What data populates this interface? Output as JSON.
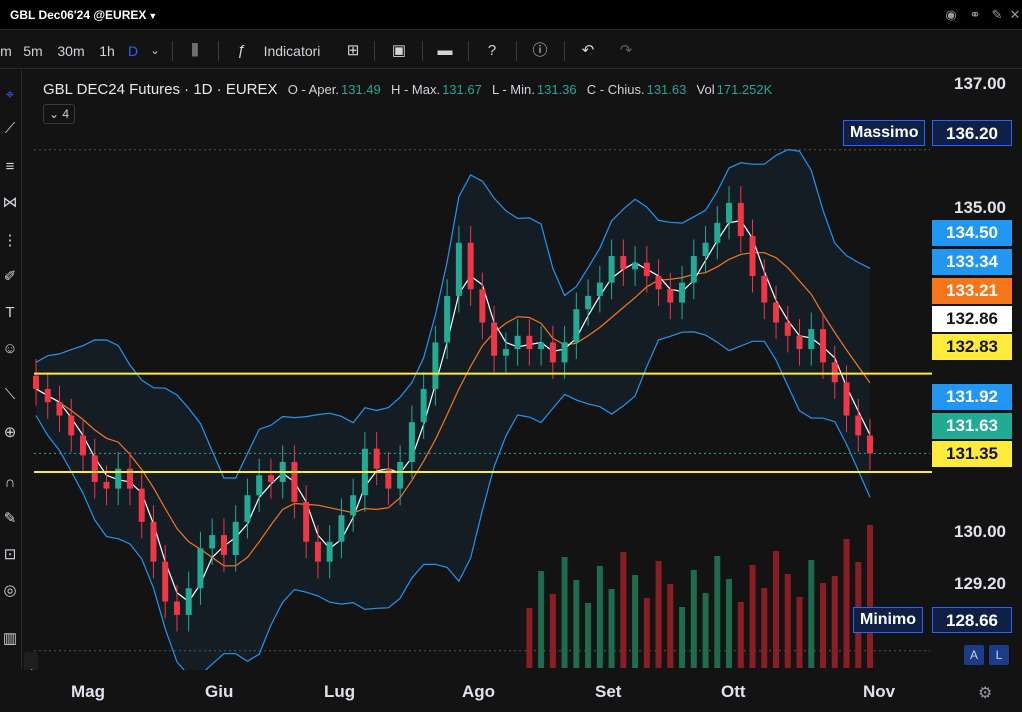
{
  "window": {
    "title": "GBL Dec06'24 @EUREX"
  },
  "toolbar": {
    "tf_m": "m",
    "tf_5m": "5m",
    "tf_30m": "30m",
    "tf_1h": "1h",
    "tf_d": "D",
    "indicators_label": "Indicatori"
  },
  "legend": {
    "symbol": "GBL DEC24 Futures · 1D · EUREX",
    "open_label": "O - Aper.",
    "open": "131.49",
    "high_label": "H - Max.",
    "high": "131.67",
    "low_label": "L - Min.",
    "low": "131.36",
    "close_label": "C - Chius.",
    "close": "131.63",
    "vol_label": "Vol",
    "vol": "171.252K",
    "indicator_count": "4"
  },
  "price_axis": {
    "ticks": [
      "137.00",
      "135.00",
      "130.00",
      "129.20"
    ],
    "max_tag": "Massimo",
    "max_value": "136.20",
    "min_tag": "Minimo",
    "min_value": "128.66",
    "labels": [
      {
        "value": "134.50",
        "color": "#2196f3",
        "text_color": "#ffffff"
      },
      {
        "value": "133.34",
        "color": "#2196f3",
        "text_color": "#ffffff"
      },
      {
        "value": "133.21",
        "color": "#f7761c",
        "text_color": "#ffffff"
      },
      {
        "value": "132.86",
        "color": "#ffffff",
        "text_color": "#131313"
      },
      {
        "value": "132.83",
        "color": "#ffeb3b",
        "text_color": "#131313"
      },
      {
        "value": "131.92",
        "color": "#2196f3",
        "text_color": "#ffffff"
      },
      {
        "value": "131.63",
        "color": "#22ab94",
        "text_color": "#ffffff"
      },
      {
        "value": "131.35",
        "color": "#ffeb3b",
        "text_color": "#131313"
      }
    ]
  },
  "time_axis": {
    "months": [
      "Mag",
      "Giu",
      "Lug",
      "Ago",
      "Set",
      "Ott",
      "Nov"
    ]
  },
  "scale_buttons": {
    "auto": "A",
    "log": "L"
  },
  "colors": {
    "up": "#22ab94",
    "down": "#f23645",
    "hline": "#ffeb3b",
    "band": "#2196f3",
    "ma_fast": "#ffffff",
    "ma_slow": "#f7761c"
  },
  "chart_data": {
    "type": "candlestick",
    "title": "GBL DEC24 Futures · 1D · EUREX",
    "ylim": [
      128.4,
      137.4
    ],
    "horizontal_lines": [
      132.83,
      131.35
    ],
    "last": {
      "open": 131.49,
      "high": 131.67,
      "low": 131.36,
      "close": 131.63,
      "volume": "171.252K"
    },
    "x": [
      "Mag",
      "Giu",
      "Lug",
      "Ago",
      "Set",
      "Ott",
      "Nov"
    ],
    "closes": [
      132.6,
      132.4,
      132.2,
      131.9,
      131.6,
      131.2,
      131.1,
      131.4,
      131.1,
      130.6,
      130.0,
      129.4,
      129.2,
      129.6,
      130.2,
      130.4,
      130.1,
      130.6,
      131.0,
      131.3,
      131.2,
      131.5,
      130.9,
      130.3,
      130.0,
      130.3,
      130.7,
      131.0,
      131.7,
      131.4,
      131.1,
      131.5,
      132.1,
      132.6,
      133.3,
      134.0,
      134.8,
      134.1,
      133.6,
      133.1,
      133.2,
      133.4,
      133.2,
      133.3,
      133.0,
      133.3,
      133.8,
      134.0,
      134.2,
      134.6,
      134.4,
      134.5,
      134.3,
      134.1,
      133.9,
      134.2,
      134.6,
      134.8,
      135.1,
      135.4,
      134.9,
      134.3,
      133.9,
      133.6,
      133.4,
      133.2,
      133.5,
      133.0,
      132.7,
      132.2,
      131.9,
      131.63
    ],
    "volume_bars": 30
  }
}
